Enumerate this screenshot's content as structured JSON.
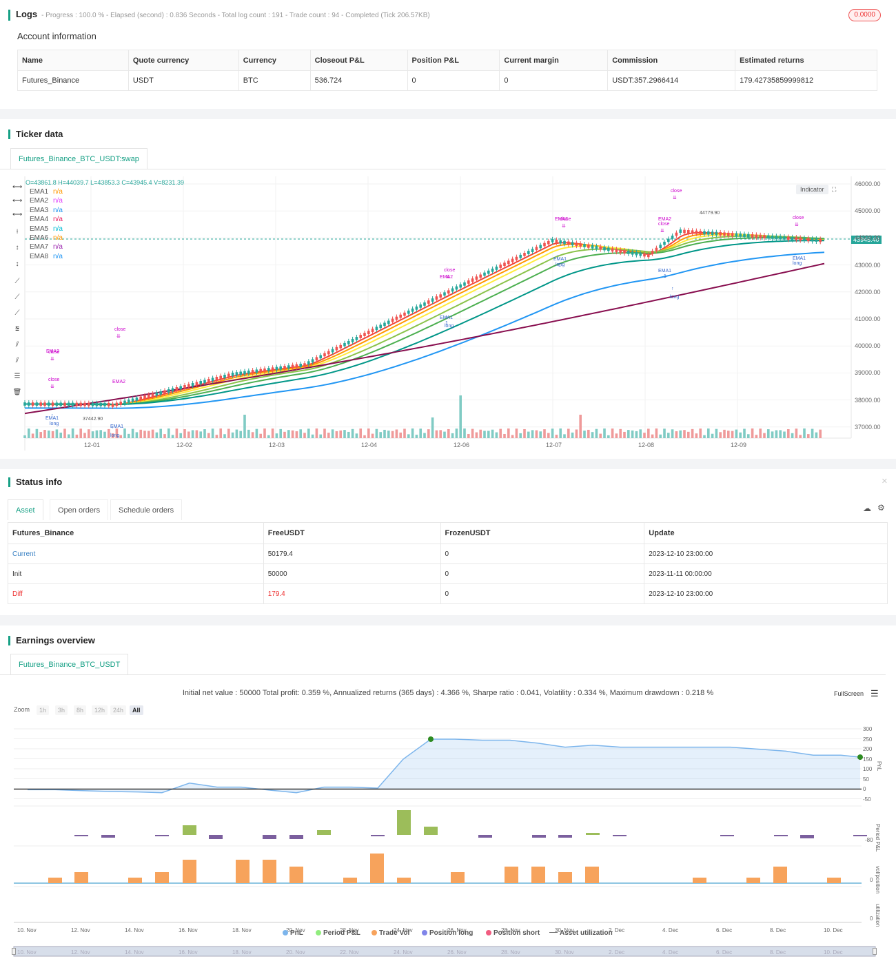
{
  "logs": {
    "title": "Logs",
    "meta": "- Progress : 100.0 % - Elapsed (second) : 0.836  Seconds - Total log count : 191 - Trade count : 94 - Completed (Tick 206.57KB)",
    "badge": "0.0000"
  },
  "account": {
    "title": "Account information",
    "headers": [
      "Name",
      "Quote currency",
      "Currency",
      "Closeout P&L",
      "Position P&L",
      "Current margin",
      "Commission",
      "Estimated returns"
    ],
    "row": [
      "Futures_Binance",
      "USDT",
      "BTC",
      "536.724",
      "0",
      "0",
      "USDT:357.2966414",
      "179.42735859999812"
    ]
  },
  "ticker": {
    "title": "Ticker data",
    "tab": "Futures_Binance_BTC_USDT:swap",
    "ohlc": "O=43861.8 H=44039.7 L=43853.3 C=43945.4 V=8231.39",
    "indicator_btn": "Indicator",
    "price_tag": "43945.40",
    "high_label": "44779.90",
    "low_label": "37442.90",
    "emas": [
      {
        "name": "EMA1",
        "val": "n/a",
        "color": "#ff9800"
      },
      {
        "name": "EMA2",
        "val": "n/a",
        "color": "#e040fb"
      },
      {
        "name": "EMA3",
        "val": "n/a",
        "color": "#2196f3"
      },
      {
        "name": "EMA4",
        "val": "n/a",
        "color": "#e91e63"
      },
      {
        "name": "EMA5",
        "val": "n/a",
        "color": "#00bcd4"
      },
      {
        "name": "EMA6",
        "val": "n/a",
        "color": "#ff9800"
      },
      {
        "name": "EMA7",
        "val": "n/a",
        "color": "#9c27b0"
      },
      {
        "name": "EMA8",
        "val": "n/a",
        "color": "#2196f3"
      }
    ],
    "y_ticks": [
      "46000.00",
      "45000.00",
      "44000.00",
      "43000.00",
      "42000.00",
      "41000.00",
      "40000.00",
      "39000.00",
      "38000.00",
      "37000.00"
    ],
    "x_ticks": [
      "12-01",
      "12-02",
      "12-03",
      "12-04",
      "12-06",
      "12-07",
      "12-08",
      "12-09"
    ],
    "marks": {
      "close": "close",
      "long": "long",
      "ema1": "EMA1",
      "ema2": "EMA2",
      "one": "1"
    }
  },
  "status": {
    "title": "Status info",
    "tabs": [
      "Asset",
      "Open orders",
      "Schedule orders"
    ],
    "headers": [
      "Futures_Binance",
      "FreeUSDT",
      "FrozenUSDT",
      "Update"
    ],
    "rows": [
      [
        "Current",
        "50179.4",
        "0",
        "2023-12-10 23:00:00"
      ],
      [
        "Init",
        "50000",
        "0",
        "2023-11-11 00:00:00"
      ],
      [
        "Diff",
        "179.4",
        "0",
        "2023-12-10 23:00:00"
      ]
    ]
  },
  "earnings": {
    "title": "Earnings overview",
    "tab": "Futures_Binance_BTC_USDT",
    "summary": "Initial net value : 50000 Total profit: 0.359 %, Annualized returns (365 days) : 4.366 %, Sharpe ratio : 0.041, Volatility : 0.334 %, Maximum drawdown : 0.218 %",
    "fullscreen": "FullScreen",
    "zoom_label": "Zoom",
    "zoom_opts": [
      "1h",
      "3h",
      "8h",
      "12h",
      "24h",
      "All"
    ],
    "pnl_ticks": [
      "300",
      "250",
      "200",
      "150",
      "100",
      "50",
      "0",
      "-50"
    ],
    "period_tick": "-80",
    "zero": "0",
    "axis_titles": [
      "PnL",
      "Period P&L",
      "vol/position",
      "utilization"
    ],
    "x_ticks": [
      "10. Nov",
      "12. Nov",
      "14. Nov",
      "16. Nov",
      "18. Nov",
      "20. Nov",
      "22. Nov",
      "24. Nov",
      "26. Nov",
      "28. Nov",
      "30. Nov",
      "2. Dec",
      "4. Dec",
      "6. Dec",
      "8. Dec",
      "10. Dec"
    ],
    "legend": [
      {
        "name": "PnL",
        "color": "#7cb5ec"
      },
      {
        "name": "Period P&L",
        "color": "#90ed7d"
      },
      {
        "name": "Trade Vol",
        "color": "#f7a35c"
      },
      {
        "name": "Position long",
        "color": "#8085e9"
      },
      {
        "name": "Position short",
        "color": "#f15c80"
      },
      {
        "name": "Asset utilization",
        "color": "#666"
      }
    ]
  }
}
